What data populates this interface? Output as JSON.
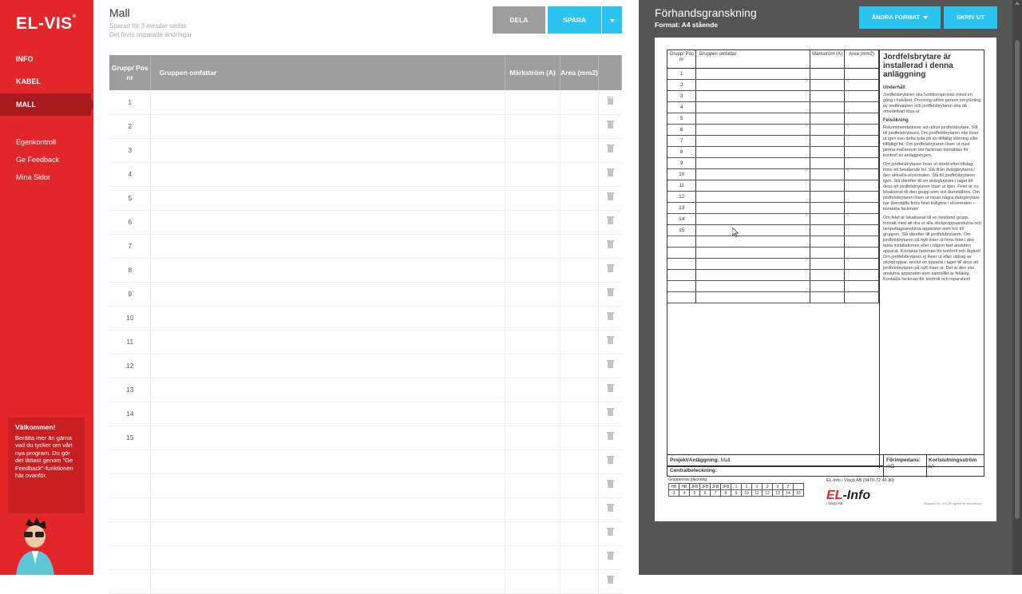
{
  "brand": {
    "logo": "EL-VIS",
    "reg": "®"
  },
  "nav": [
    {
      "label": "INFO"
    },
    {
      "label": "KABEL"
    },
    {
      "label": "MALL",
      "active": true
    }
  ],
  "subnav": [
    "Egenkontroll",
    "Ge Feedback",
    "Mina Sidor"
  ],
  "welcome": {
    "title": "Välkommen!",
    "text": "Berätta mer än gärna vad du tycker om vårt nya program. Du gör det lättast genom \"Ge Feedback\"-funktionen här ovanför."
  },
  "main": {
    "title": "Mall",
    "saved": "Sparad för 3 minuter sedan",
    "unsaved": "Det finns osparade ändringar",
    "btn_share": "DELA",
    "btn_save": "SPARA",
    "columns": [
      "Grupp/ Pos nr",
      "Gruppen omfattar",
      "Märkström (A)",
      "Area (mm2)"
    ],
    "rows": [
      "1",
      "2",
      "3",
      "4",
      "5",
      "6",
      "7",
      "8",
      "9",
      "10",
      "11",
      "12",
      "13",
      "14",
      "15",
      "",
      "",
      "",
      "",
      "",
      ""
    ]
  },
  "preview": {
    "title": "Förhandsgranskning",
    "format": "Format: A4 stående",
    "btn_format": "ÄNDRA FORMAT",
    "btn_print": "SKRIV UT",
    "doc": {
      "columns": [
        "Grupp/ Pos nr",
        "Gruppen omfattar",
        "Märkström (A)",
        "Area (mm2)"
      ],
      "rows": [
        "1",
        "2",
        "3",
        "4",
        "5",
        "6",
        "7",
        "8",
        "9",
        "10",
        "11",
        "12",
        "13",
        "14",
        "15",
        "",
        "",
        "",
        "",
        "",
        ""
      ],
      "side_heading": "Jordfelsbrytare är installerad i denna anläggning",
      "sec1": "Underhåll",
      "p1": "Jordfelsbrytaren ska funktionsprovas minst en gång i halvåret. Provning utförs genom intryckning av testknappen och jordfelsbrytaren ska då omedelbart lösa ut.",
      "sec2": "Felsökning",
      "p2": "Rekommendationer vid utlöst jordfelsbrytare. Slå till jordfelsbrytaren. Om jordfelsbrytaren inte löser ut igen kan detta tyda på en tillfällig störning eller tillfälligt fel. Om jordfelsbrytaren löser ut med jämna mellanrum bör fackman kontaktas för kontroll av anläggningen.",
      "p3": "Om jordfelsbrytaren löser ut direkt efter tillslag finns ett bestående fel. Slå ifrån dvärgbrytarna i den aktuella elcentralen. Slå till jordfelsbrytaren igen. Slå därefter till en dvärgbrytare i taget till dess att jordfelsbrytaren löser ut igen. Felet är nu lokaliserat till den grupp som sist återställdes. Om jordfelsbrytaren löser ut innan några dvärgbrytare har återställts finns felet troligtvis i elcentralen – kontakta fackman!",
      "p4": "Om felet är lokaliserat till en bestämd grupp, fortsätt med att dra ur alla stickproppsanslutna och lamputtagsanslutna apparater som hör till gruppen. Slå därefter till jordfelsbrytaren. Om jordfelsbrytaren på nytt löser ut finns felet i den fasta installationen eller i någon fast ansluten apparat. Kontakta fackman för kontroll och åtgärd! Om jordfelsbrytaren ej löser ut efter utdrag av stickproppar, anslut en apparat i taget till dess att jordfelsbrytaren på nytt löser ut. Det är den sist anslutna apparaten som sannolikt är felaktig. Kontakta fackman för kontroll och reparation!",
      "project_label": "Projekt/Anläggning:",
      "project_value": "Mall",
      "central_label": "Centralbeteckning:",
      "impedance_label": "Förimpedans:",
      "impedance_unit": "mΩ",
      "shortcircuit_label": "Kortslutningsström",
      "shortcircuit_unit": "kA",
      "mini_label": "Gruppernas placering",
      "mini_top": [
        "HB",
        "HB",
        "JFB",
        "JFB",
        "JFB",
        "JFB",
        "1",
        "1",
        "1",
        "2",
        "2",
        "2",
        ""
      ],
      "mini_bottom": [
        "3",
        "4",
        "5",
        "6",
        "7",
        "8",
        "9",
        "10",
        "11",
        "12",
        "13",
        "14",
        "15"
      ],
      "company_info": "EL-Info i Växjö AB (0470-72 40 30)",
      "company_logo_a": "EL",
      "company_logo_b": "-Info",
      "company_small": "i Växjö AB",
      "footer_small": "Skapad i EL-VIS (Program för elrevision)"
    }
  },
  "colors": {
    "brand_red": "#e3262a",
    "accent": "#2bc4f0",
    "preview_bg": "#555555"
  }
}
